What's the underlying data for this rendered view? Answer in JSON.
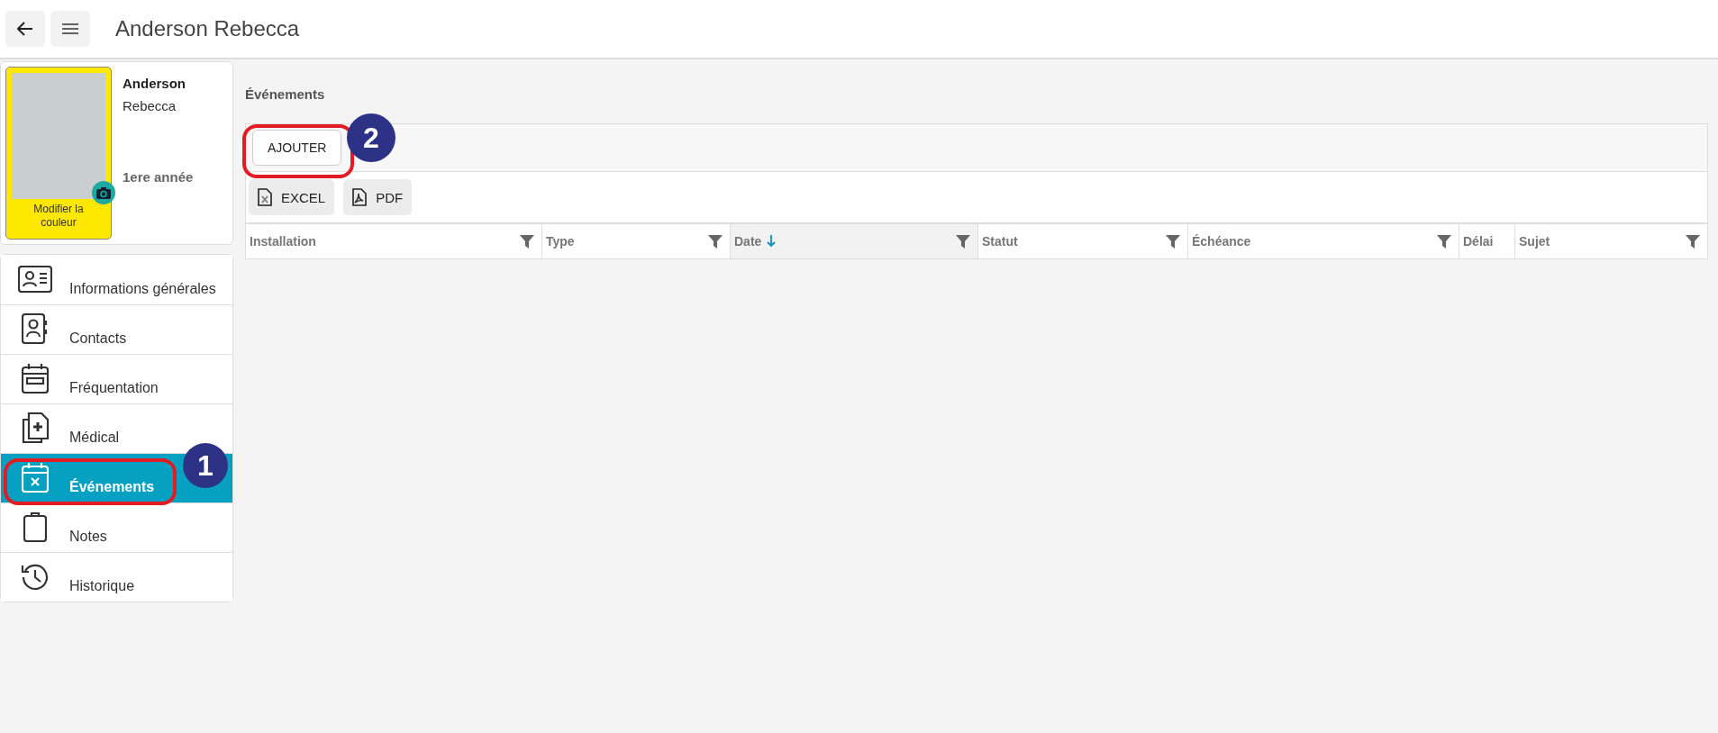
{
  "header": {
    "title": "Anderson Rebecca"
  },
  "profile": {
    "last_name": "Anderson",
    "first_name": "Rebecca",
    "grade": "1ere année",
    "photo_caption": "Modifier la couleur"
  },
  "nav": [
    {
      "label": "Informations générales",
      "kind": "idcard",
      "selected": false
    },
    {
      "label": "Contacts",
      "kind": "contacts",
      "selected": false
    },
    {
      "label": "Fréquentation",
      "kind": "calendar",
      "selected": false
    },
    {
      "label": "Médical",
      "kind": "medical",
      "selected": false
    },
    {
      "label": "Événements",
      "kind": "event",
      "selected": true,
      "callout": "1"
    },
    {
      "label": "Notes",
      "kind": "clipboard",
      "selected": false
    },
    {
      "label": "Historique",
      "kind": "history",
      "selected": false
    }
  ],
  "section_title": "Événements",
  "add_button": {
    "label": "AJOUTER",
    "callout": "2"
  },
  "export_buttons": [
    {
      "label": "EXCEL",
      "kind": "excel"
    },
    {
      "label": "PDF",
      "kind": "pdf"
    }
  ],
  "table": {
    "columns": [
      {
        "label": "Installation",
        "filterable": true,
        "sorted": false
      },
      {
        "label": "Type",
        "filterable": true,
        "sorted": false
      },
      {
        "label": "Date",
        "filterable": true,
        "sorted": true
      },
      {
        "label": "Statut",
        "filterable": true,
        "sorted": false
      },
      {
        "label": "Échéance",
        "filterable": true,
        "sorted": false
      },
      {
        "label": "Délai",
        "filterable": false,
        "sorted": false
      },
      {
        "label": "Sujet",
        "filterable": true,
        "sorted": false
      }
    ]
  }
}
